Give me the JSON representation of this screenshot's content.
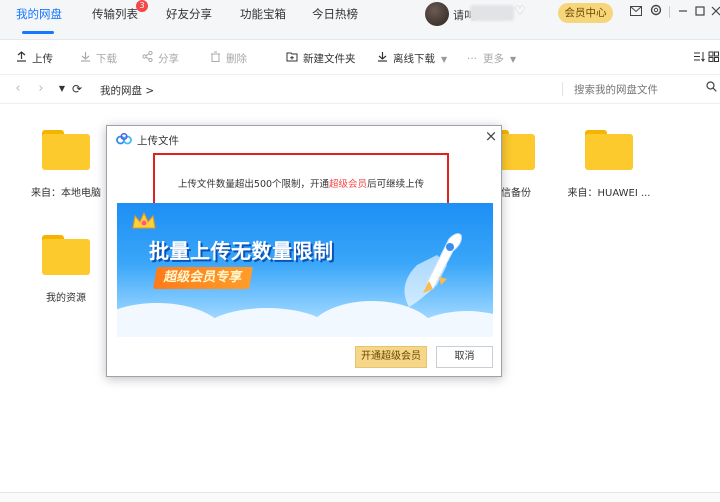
{
  "nav": {
    "tabs": [
      {
        "label": "我的网盘"
      },
      {
        "label": "传输列表",
        "badge": "3"
      },
      {
        "label": "好友分享"
      },
      {
        "label": "功能宝箱"
      },
      {
        "label": "今日热榜"
      }
    ],
    "username": "请叫",
    "vip_center": "会员中心",
    "icons": [
      "mail-icon",
      "settings-icon",
      "minimize-icon",
      "maximize-icon",
      "close-icon"
    ]
  },
  "toolbar": {
    "upload": "上传",
    "download": "下载",
    "share": "分享",
    "delete": "删除",
    "new_folder": "新建文件夹",
    "offline_download": "离线下载",
    "more": "更多"
  },
  "pathbar": {
    "breadcrumb": "我的网盘  >",
    "search_placeholder": "搜索我的网盘文件"
  },
  "files": [
    {
      "label": "来自：本地电脑"
    },
    {
      "label": "微信备份"
    },
    {
      "label": "来自：HUAWEI ..."
    },
    {
      "label": "我的资源"
    }
  ],
  "dialog": {
    "title": "上传文件",
    "message_prefix": "上传文件数量超出500个限制，开通",
    "message_link": "超级会员",
    "message_suffix": "后可继续上传",
    "banner_headline": "批量上传无数量限制",
    "banner_tag": "超级会员专享",
    "vip_button": "开通超级会员",
    "cancel_button": "取消"
  },
  "colors": {
    "accent": "#1677ff",
    "badge": "#f5484a",
    "folder": "#fcca2d",
    "vip": "#f7d57a",
    "highlight_border": "#e0221d"
  }
}
